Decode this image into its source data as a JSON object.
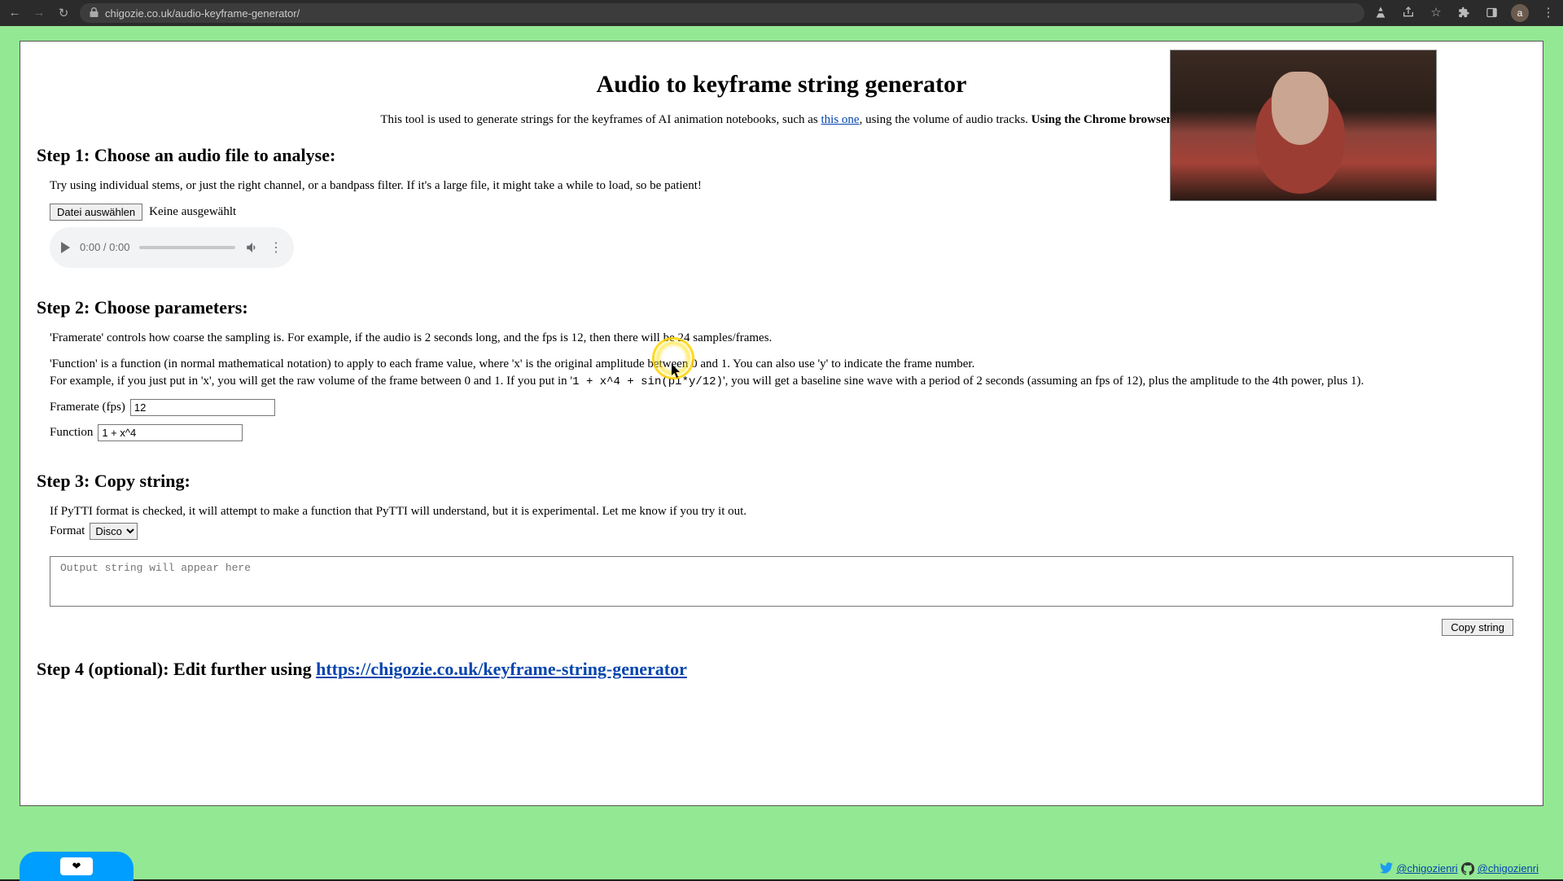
{
  "browser": {
    "url": "chigozie.co.uk/audio-keyframe-generator/",
    "avatar_letter": "a"
  },
  "webcam": {
    "present": true
  },
  "page": {
    "title": "Audio to keyframe string generator",
    "intro_pre": "This tool is used to generate strings for the keyframes of AI animation notebooks, such as ",
    "intro_link": "this one",
    "intro_mid": ", using the volume of audio tracks. ",
    "intro_bold": "Using the Chrome browser is"
  },
  "step1": {
    "heading": "Step 1: Choose an audio file to analyse:",
    "tip": "Try using individual stems, or just the right channel, or a bandpass filter. If it's a large file, it might take a while to load, so be patient!",
    "file_button": "Datei auswählen",
    "file_status": "Keine ausgewählt",
    "audio_time": "0:00 / 0:00"
  },
  "step2": {
    "heading": "Step 2: Choose parameters:",
    "framerate_desc": "'Framerate' controls how coarse the sampling is. For example, if the audio is 2 seconds long, and the fps is 12, then there will be 24 samples/frames.",
    "function_desc_1": "'Function' is a function (in normal mathematical notation) to apply to each frame value, where 'x' is the original amplitude between 0 and 1. You can also use 'y' to indicate the frame number.",
    "function_desc_2a": "For example, if you just put in 'x', you will get the raw volume of the frame between 0 and 1. If you put in '",
    "function_code": "1 + x^4 + sin(pi*y/12)",
    "function_desc_2b": "', you will get a baseline sine wave with a period of 2 seconds (assuming an fps of 12), plus the amplitude to the 4th power, plus 1).",
    "framerate_label": "Framerate (fps)",
    "framerate_value": "12",
    "function_label": "Function",
    "function_value": "1 + x^4"
  },
  "step3": {
    "heading": "Step 3: Copy string:",
    "pytti_note": "If PyTTI format is checked, it will attempt to make a function that PyTTI will understand, but it is experimental. Let me know if you try it out.",
    "format_label": "Format",
    "format_value": "Disco",
    "output_placeholder": "Output string will appear here",
    "copy_button": "Copy string"
  },
  "step4": {
    "heading_pre": "Step 4 (optional): Edit further using ",
    "link_text": "https://chigozie.co.uk/keyframe-string-generator"
  },
  "footer": {
    "twitter": "@chigozienri",
    "github": "@chigozienri"
  }
}
